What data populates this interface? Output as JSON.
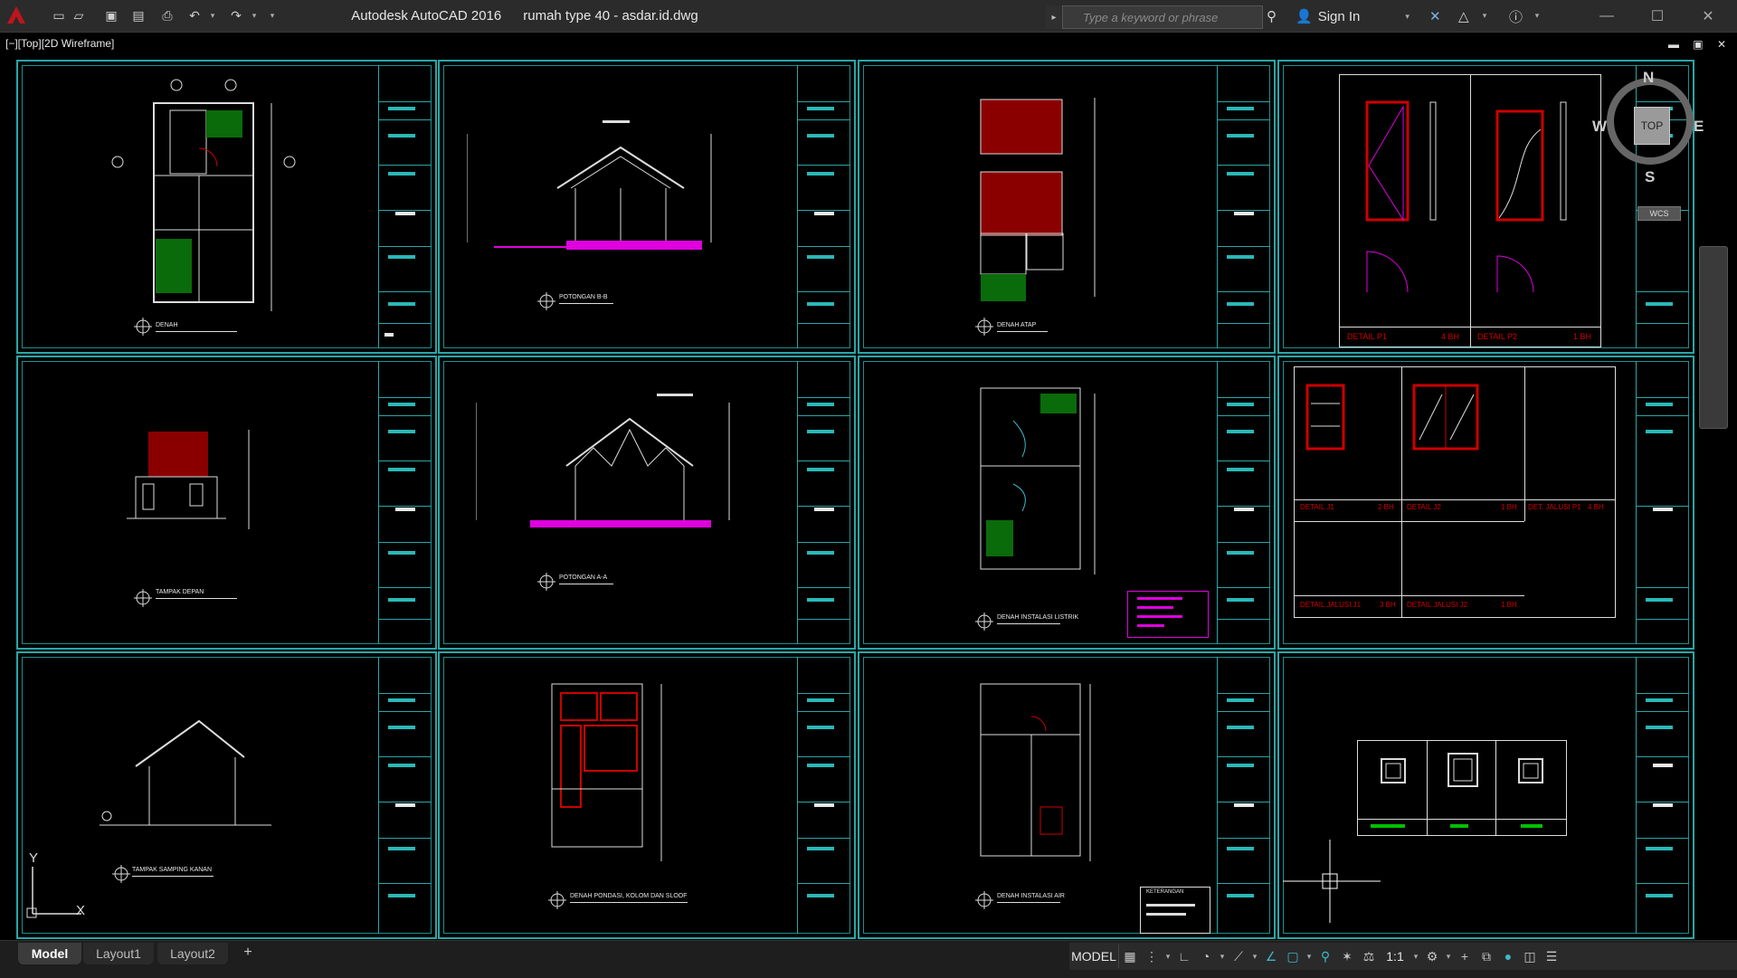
{
  "app": {
    "name": "Autodesk AutoCAD 2016",
    "file": "rumah type 40 - asdar.id.dwg"
  },
  "search": {
    "placeholder": "Type a keyword or phrase"
  },
  "account": {
    "signin_label": "Sign In"
  },
  "viewport": {
    "label": "[−][Top][2D Wireframe]"
  },
  "viewcube": {
    "north": "N",
    "south": "S",
    "east": "E",
    "west": "W",
    "top": "TOP",
    "wcs": "WCS"
  },
  "ucs": {
    "x": "X",
    "y": "Y"
  },
  "tabs": [
    {
      "label": "Model"
    },
    {
      "label": "Layout1"
    },
    {
      "label": "Layout2"
    }
  ],
  "status": {
    "model_label": "MODEL",
    "scale": "1:1"
  },
  "sheets": [
    {
      "label": "DENAH"
    },
    {
      "label": "POTONGAN B-B"
    },
    {
      "label": "DENAH ATAP"
    },
    {
      "label": "DETAIL P1"
    },
    {
      "label": "TAMPAK DEPAN"
    },
    {
      "label": "POTONGAN A-A"
    },
    {
      "label": "DENAH INSTALASI LISTRIK"
    },
    {
      "label": "DETAIL J1"
    },
    {
      "label": "TAMPAK SAMPING KANAN"
    },
    {
      "label": "DENAH PONDASI, KOLOM DAN SLOOF"
    },
    {
      "label": "DENAH INSTALASI AIR"
    },
    {
      "label": ""
    }
  ],
  "details": {
    "p1": "DETAIL P1",
    "p1_qty": "4 BH",
    "p2": "DETAIL P2",
    "p2_qty": "1 BH",
    "j1": "DETAIL J1",
    "j1_qty": "2 BH",
    "j2": "DETAIL J2",
    "j2_qty": "1 BH",
    "jp1": "DET. JALUSI P1",
    "jp1_qty": "4 BH",
    "jj1": "DETAIL JALUSI J1",
    "jj1_qty": "3 BH",
    "jj2": "DETAIL JALUSI J2",
    "jj2_qty": "1 BH",
    "keterangan": "KETERANGAN"
  },
  "colors": {
    "accent": "#2aa6a6",
    "red": "#c00000",
    "magenta": "#e000e0",
    "green": "#00c000"
  }
}
